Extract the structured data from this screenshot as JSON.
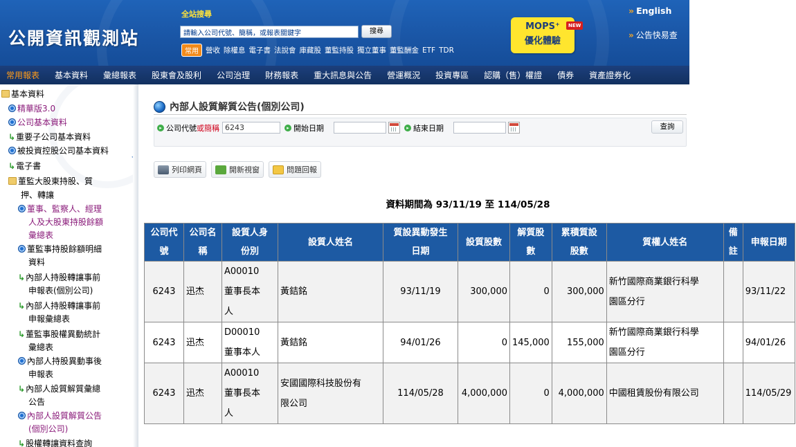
{
  "header": {
    "logo": "公開資訊觀測站",
    "search_title": "全站搜尋",
    "search_placeholder": "請輸入公司代號、簡稱，或報表關鍵字",
    "search_button": "搜尋",
    "quick_tag": "常用",
    "quick_links": [
      "營收",
      "除權息",
      "電子書",
      "法說會",
      "庫藏股",
      "董監持股",
      "獨立董事",
      "董監酬金",
      "ETF",
      "TDR"
    ],
    "mops_line1": "MOPS⁺",
    "mops_line2": "優化體驗",
    "new_badge": "NEW",
    "english": "English",
    "announcement": "公告快易查"
  },
  "nav": {
    "items": [
      "常用報表",
      "基本資料",
      "彙總報表",
      "股東會及股利",
      "公司治理",
      "財務報表",
      "重大訊息與公告",
      "營運概況",
      "投資專區",
      "認購（售）權證",
      "債券",
      "資產證券化"
    ],
    "active_index": 0
  },
  "sidebar": {
    "items": [
      "基本資料",
      "精華版3.0",
      "公司基本資料",
      "重要子公司基本資料",
      "被投資控股公司基本資料",
      "電子書",
      "董監大股東持股、質",
      "押、轉讓",
      "董事、監察人、經理",
      "人及大股東持股餘額",
      "彙總表",
      "董監事持股餘額明細",
      "資料",
      "內部人持股轉讓事前",
      "申報表(個別公司)",
      "內部人持股轉讓事前",
      "申報彙總表",
      "董監事股權異動統計",
      "彙總表",
      "內部人持股異動事後",
      "申報表",
      "內部人設質解質彙總",
      "公告",
      "內部人設質解質公告",
      "(個別公司)",
      "股權轉讓資料查詢"
    ]
  },
  "main": {
    "page_title": "內部人設質解質公告(個別公司)",
    "query": {
      "company_label": "公司代號",
      "company_label_red": "或簡稱",
      "company_value": "6243",
      "start_label": "開始日期",
      "end_label": "結束日期",
      "submit": "查詢"
    },
    "tools": {
      "print": "列印網頁",
      "new_window": "開新視窗",
      "feedback": "問題回報"
    },
    "period": "資料期間為 93/11/19 至 114/05/28",
    "table": {
      "headers": {
        "h0a": "公司代",
        "h0b": "號",
        "h1a": "公司名",
        "h1b": "稱",
        "h2a": "設質人身",
        "h2b": "份別",
        "h3": "設質人姓名",
        "h4a": "質設異動發生",
        "h4b": "日期",
        "h5": "設質股數",
        "h6a": "解質股",
        "h6b": "數",
        "h7a": "累積質設",
        "h7b": "股數",
        "h8": "質權人姓名",
        "h9a": "備",
        "h9b": "註",
        "h10": "申報日期"
      },
      "rows": [
        {
          "code": "6243",
          "name": "迅杰",
          "id1": "A00010",
          "id2": "董事長本",
          "id3": "人",
          "pledgor": "黃銡銘",
          "date": "93/11/19",
          "pledged": "300,000",
          "released": "0",
          "cumulative": "300,000",
          "pledgee1": "新竹國際商業銀行科學",
          "pledgee2": "園區分行",
          "note": "",
          "filing": "93/11/22"
        },
        {
          "code": "6243",
          "name": "迅杰",
          "id1": "D00010",
          "id2": "董事本人",
          "pledgor": "黃銡銘",
          "date": "94/01/26",
          "pledged": "0",
          "released": "145,000",
          "cumulative": "155,000",
          "pledgee1": "新竹國際商業銀行科學",
          "pledgee2": "園區分行",
          "note": "",
          "filing": "94/01/26"
        },
        {
          "code": "6243",
          "name": "迅杰",
          "id1": "A00010",
          "id2": "董事長本",
          "id3": "人",
          "pledgor1": "安國國際科技股份有",
          "pledgor2": "限公司",
          "date": "114/05/28",
          "pledged": "4,000,000",
          "released": "0",
          "cumulative": "4,000,000",
          "pledgee": "中國租賃股份有限公司",
          "note": "",
          "filing": "114/05/29"
        }
      ]
    }
  },
  "colors": {
    "header_blue": "#1a56a6",
    "nav_dark": "#12305f",
    "nav_active": "#ff9c1a",
    "table_header": "#1d5aa3",
    "sidebar_link": "#8a1b7a",
    "mops_yellow": "#ffe52e"
  }
}
